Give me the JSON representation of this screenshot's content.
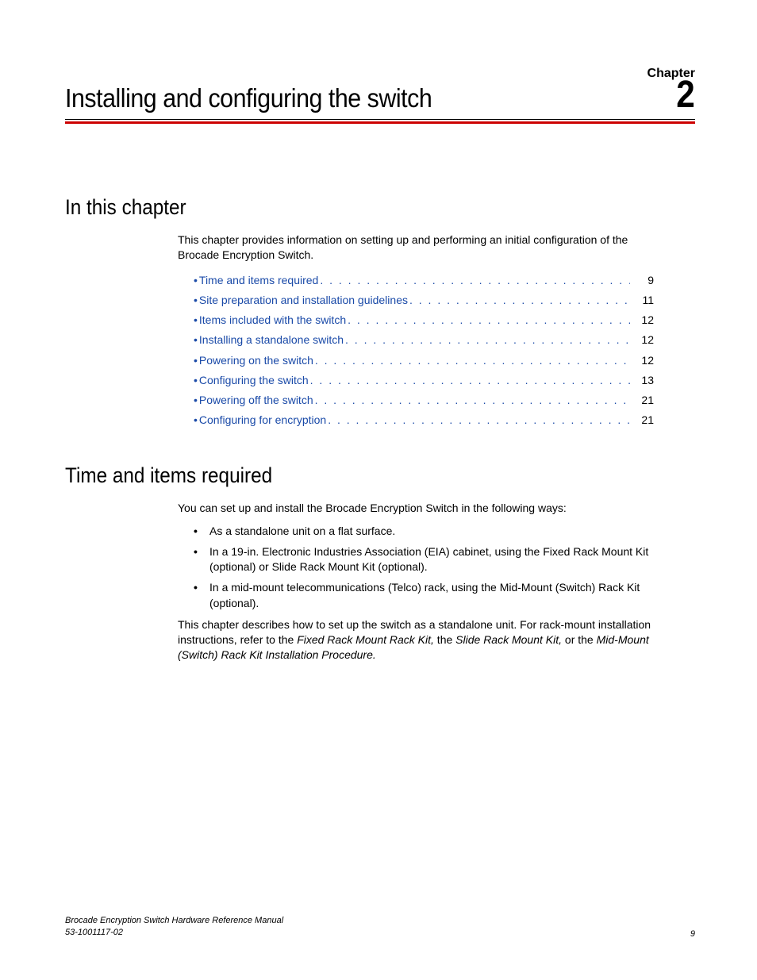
{
  "header": {
    "chapter_label": "Chapter",
    "title": "Installing and configuring the switch",
    "number": "2"
  },
  "sec_in_chapter": {
    "heading": "In this chapter",
    "intro": "This chapter provides information on setting up and performing an initial configuration of the Brocade Encryption Switch.",
    "toc": [
      {
        "label": "Time and items required",
        "page": "9"
      },
      {
        "label": "Site preparation and installation guidelines",
        "page": "11"
      },
      {
        "label": "Items included with the switch",
        "page": "12"
      },
      {
        "label": "Installing a standalone switch",
        "page": "12"
      },
      {
        "label": "Powering on the switch",
        "page": "12"
      },
      {
        "label": "Configuring the switch",
        "page": "13"
      },
      {
        "label": "Powering off the switch",
        "page": "21"
      },
      {
        "label": "Configuring for encryption",
        "page": "21"
      }
    ]
  },
  "sec_time_items": {
    "heading": "Time and items required",
    "intro": "You can set up and install the Brocade Encryption Switch in the following ways:",
    "bullets": [
      "As a standalone unit on a flat surface.",
      "In a 19-in. Electronic Industries Association (EIA) cabinet, using the Fixed Rack Mount Kit (optional) or Slide Rack Mount Kit (optional).",
      "In a mid-mount telecommunications (Telco) rack, using the Mid-Mount (Switch) Rack Kit (optional)."
    ],
    "para2_pre": "This chapter describes how to set up the switch as a standalone unit. For rack-mount installation instructions, refer to the ",
    "ref1": "Fixed Rack Mount Rack Kit,",
    "mid1": " the ",
    "ref2": "Slide Rack Mount Kit,",
    "mid2": " or the ",
    "ref3": "Mid-Mount (Switch) Rack Kit Installation Procedure."
  },
  "footer": {
    "line1": "Brocade Encryption Switch Hardware Reference Manual",
    "line2": "53-1001117-02",
    "page": "9"
  }
}
